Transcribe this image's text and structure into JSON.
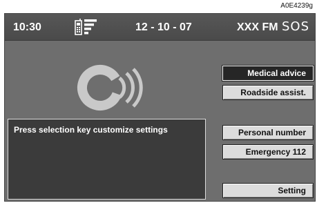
{
  "figure_code": "A0E4239g",
  "status_bar": {
    "time": "10:30",
    "date": "12 - 10 - 07",
    "radio": "XXX FM",
    "sos": "SOS",
    "phone_icon": "mobile-phone-signal-icon"
  },
  "brand_icon": "connect-service-icon",
  "message": {
    "text": "Press selection key customize settings"
  },
  "menu": {
    "items": [
      {
        "label": "Medical advice",
        "selected": true
      },
      {
        "label": "Roadside assist.",
        "selected": false
      },
      {
        "label": "Personal number",
        "selected": false
      },
      {
        "label": "Emergency 112",
        "selected": false
      },
      {
        "label": "Setting",
        "selected": false
      }
    ]
  },
  "colors": {
    "screen_bg": "#6e6e6e",
    "status_bar_bg": "#4a4a4a",
    "message_bg": "#3b3b3b",
    "selected_button_bg": "#262626",
    "button_bg": "#dcdcdc"
  }
}
